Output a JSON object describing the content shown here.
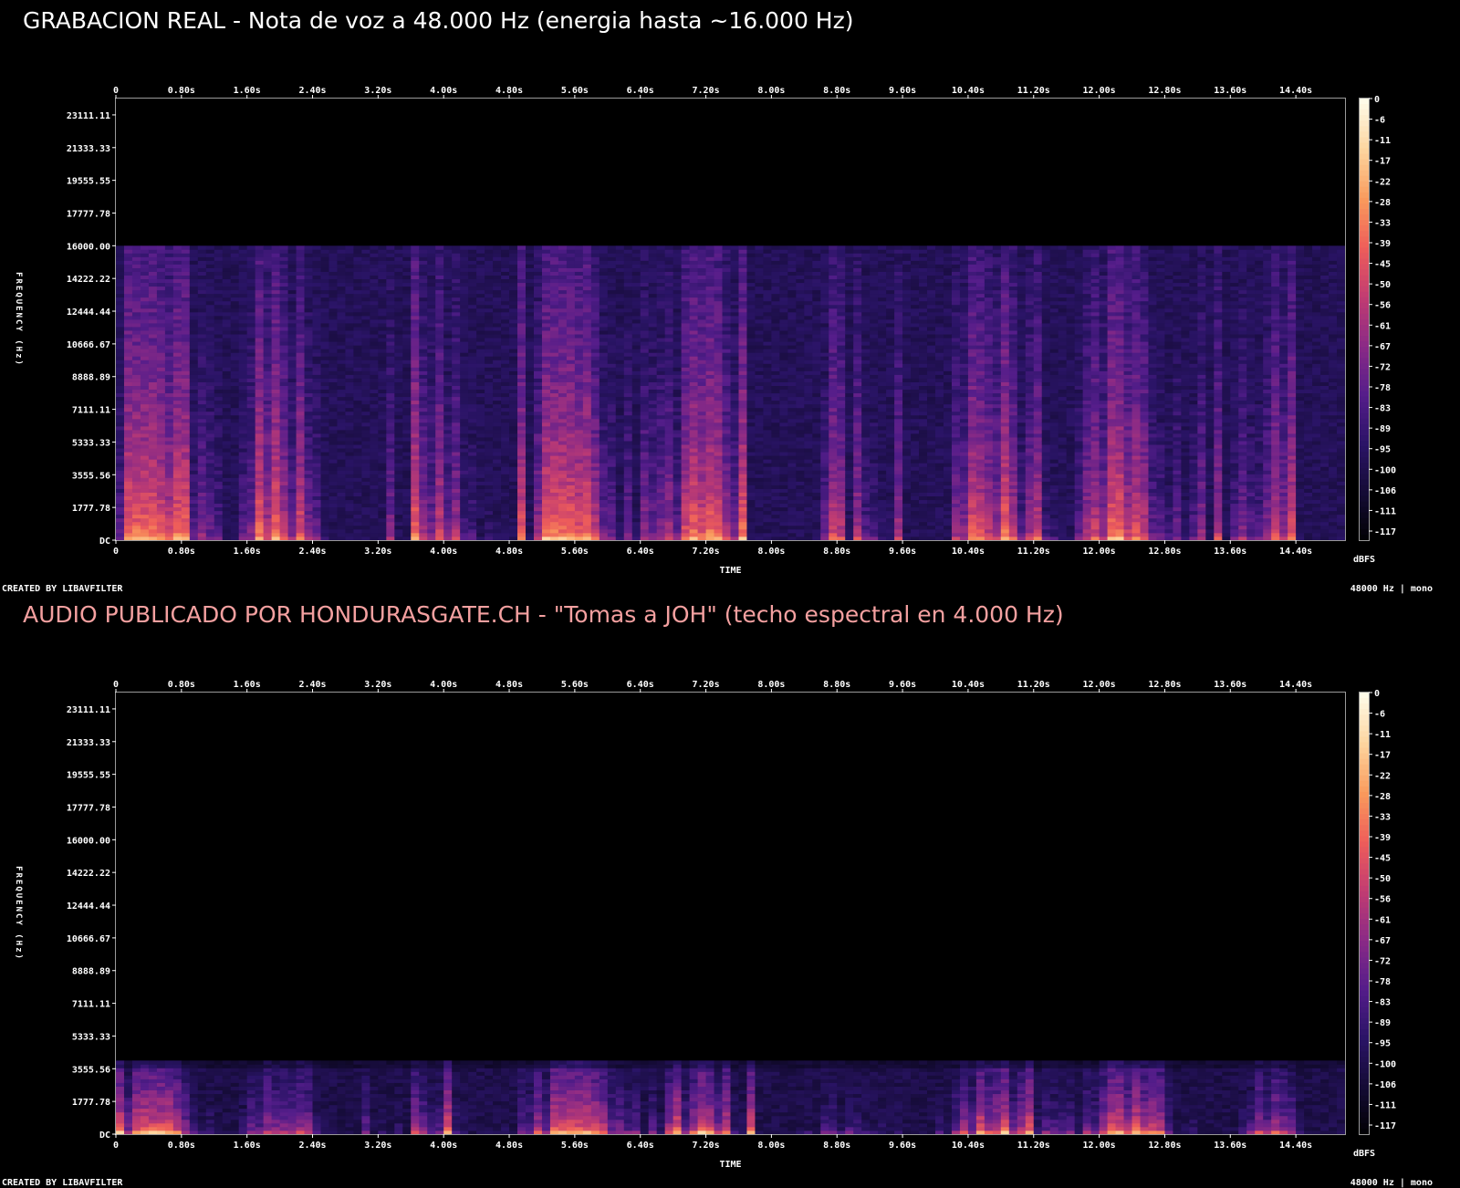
{
  "panels": [
    {
      "title": "GRABACION REAL - Nota de voz a 48.000 Hz (energia hasta ~16.000 Hz)",
      "title_color": "#ffffff",
      "footer_left": "CREATED BY LIBAVFILTER",
      "footer_right": "48000 Hz | mono"
    },
    {
      "title": "AUDIO PUBLICADO POR HONDURASGATE.CH - \"Tomas a JOH\" (techo espectral en 4.000 Hz)",
      "title_color": "#f4a0a0",
      "footer_left": "CREATED BY LIBAVFILTER",
      "footer_right": "48000 Hz | mono"
    }
  ],
  "chart_data": [
    {
      "type": "heatmap",
      "title": "GRABACION REAL - Nota de voz a 48.000 Hz (energia hasta ~16.000 Hz)",
      "xlabel": "TIME",
      "ylabel": "FREQUENCY (Hz)",
      "x_ticks": [
        "0",
        "0.80s",
        "1.60s",
        "2.40s",
        "3.20s",
        "4.00s",
        "4.80s",
        "5.60s",
        "6.40s",
        "7.20s",
        "8.00s",
        "8.80s",
        "9.60s",
        "10.40s",
        "11.20s",
        "12.00s",
        "12.80s",
        "13.60s",
        "14.40s"
      ],
      "y_ticks": [
        "23111.11",
        "21333.33",
        "19555.55",
        "17777.78",
        "16000.00",
        "14222.22",
        "12444.44",
        "10666.67",
        "8888.89",
        "7111.11",
        "5333.33",
        "3555.56",
        "1777.78",
        "DC"
      ],
      "colorbar_label": "dBFS",
      "colorbar_ticks": [
        "0",
        "-6",
        "-11",
        "-17",
        "-22",
        "-28",
        "-33",
        "-39",
        "-45",
        "-50",
        "-56",
        "-61",
        "-67",
        "-72",
        "-78",
        "-83",
        "-89",
        "-95",
        "-100",
        "-106",
        "-111",
        "-117"
      ],
      "xlim": [
        0,
        15
      ],
      "ylim": [
        0,
        24000
      ],
      "energy_ceiling_hz": 16000,
      "colormap": [
        "#000000",
        "#140b34",
        "#2a1466",
        "#541d8a",
        "#8a2a86",
        "#c13c72",
        "#ee5d5a",
        "#f99a5c",
        "#fdd49e",
        "#fffbe8"
      ]
    },
    {
      "type": "heatmap",
      "title": "AUDIO PUBLICADO POR HONDURASGATE.CH - \"Tomas a JOH\" (techo espectral en 4.000 Hz)",
      "xlabel": "TIME",
      "ylabel": "FREQUENCY (Hz)",
      "x_ticks": [
        "0",
        "0.80s",
        "1.60s",
        "2.40s",
        "3.20s",
        "4.00s",
        "4.80s",
        "5.60s",
        "6.40s",
        "7.20s",
        "8.00s",
        "8.80s",
        "9.60s",
        "10.40s",
        "11.20s",
        "12.00s",
        "12.80s",
        "13.60s",
        "14.40s"
      ],
      "y_ticks": [
        "23111.11",
        "21333.33",
        "19555.55",
        "17777.78",
        "16000.00",
        "14222.22",
        "12444.44",
        "10666.67",
        "8888.89",
        "7111.11",
        "5333.33",
        "3555.56",
        "1777.78",
        "DC"
      ],
      "colorbar_label": "dBFS",
      "colorbar_ticks": [
        "0",
        "-6",
        "-11",
        "-17",
        "-22",
        "-28",
        "-33",
        "-39",
        "-45",
        "-50",
        "-56",
        "-61",
        "-67",
        "-72",
        "-78",
        "-83",
        "-89",
        "-95",
        "-100",
        "-106",
        "-111",
        "-117"
      ],
      "xlim": [
        0,
        15
      ],
      "ylim": [
        0,
        24000
      ],
      "energy_ceiling_hz": 4000,
      "colormap": [
        "#000000",
        "#140b34",
        "#2a1466",
        "#541d8a",
        "#8a2a86",
        "#c13c72",
        "#ee5d5a",
        "#f99a5c",
        "#fdd49e",
        "#fffbe8"
      ]
    }
  ]
}
